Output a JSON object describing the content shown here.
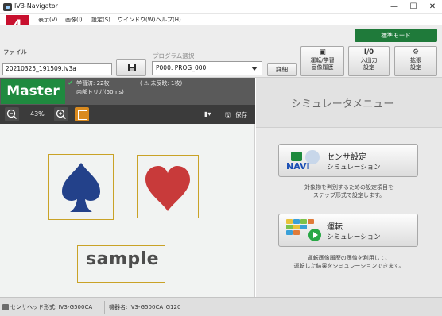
{
  "window": {
    "title": "IV3-Navigator",
    "controls": {
      "minimize": "—",
      "maximize": "☐",
      "close": "✕"
    }
  },
  "step_badge": "4",
  "menubar": {
    "items": [
      "表示(V)",
      "画像(I)",
      "設定(S)",
      "ウインドウ(W)",
      "ヘルプ(H)"
    ]
  },
  "toolbar": {
    "mode_button": "標準モード",
    "file_label": "ファイル",
    "file_value": "20210325_191509.iv3a",
    "program_label": "プログラム選択",
    "program_value": "P000: PROG_000",
    "detail_button": "詳細",
    "history_button": [
      "運転/学習",
      "画像履歴"
    ],
    "io_button": [
      "I/0",
      "入出力",
      "設定"
    ],
    "ext_button": [
      "拡張",
      "設定"
    ]
  },
  "master": {
    "label": "Master",
    "learned": "学習済: 22枚",
    "trigger": "内部トリガ(50ms)",
    "unreflected": "( ⚠ 未反映: 1枚)"
  },
  "image_toolbar": {
    "zoom_level": "43%",
    "save_label": "保存"
  },
  "image": {
    "sample_text": "sample",
    "spade_color": "#23418a",
    "heart_color": "#c83a3a",
    "roi_color": "#c9a227"
  },
  "simulation": {
    "title": "シミュレータメニュー",
    "sensor_button": {
      "line1": "センサ設定",
      "line2": "シミュレーション"
    },
    "sensor_desc": [
      "対象物を判別するための設定項目を",
      "ステップ形式で設定します。"
    ],
    "run_button": {
      "line1": "運転",
      "line2": "シミュレーション"
    },
    "run_desc": [
      "運転画像履歴の画像を利用して、",
      "運転した結果をシミュレーションできます。"
    ],
    "navi_label": "NAVI"
  },
  "statusbar": {
    "sensor_head": "センサヘッド形式: IV3-G500CA",
    "device_model": "機器名: IV3-G500CA_G120"
  }
}
